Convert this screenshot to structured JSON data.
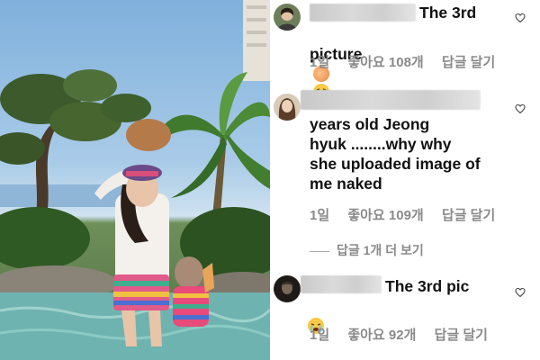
{
  "comments": [
    {
      "text": "The 3rd",
      "text2": "picture",
      "emoji": [
        "peach-emoji",
        "laughing-emoji"
      ],
      "time": "1일",
      "likes": "좋아요 108개",
      "reply": "답글 달기"
    },
    {
      "text": "years old Jeong\nhyuk ........why why\nshe uploaded image of\nme naked",
      "time": "1일",
      "likes": "좋아요 109개",
      "reply": "답글 달기"
    },
    {
      "text": "The 3rd pic",
      "emoji": [
        "crying-emoji"
      ],
      "time": "1일",
      "likes": "좋아요 92개",
      "reply": "답글 달기"
    }
  ],
  "replies_link": "답글 1개 더 보기",
  "colors": {
    "meta": "#8a8a8a",
    "text": "#111111",
    "peach": "#f4a261",
    "emoji_yellow": "#f7c948"
  }
}
